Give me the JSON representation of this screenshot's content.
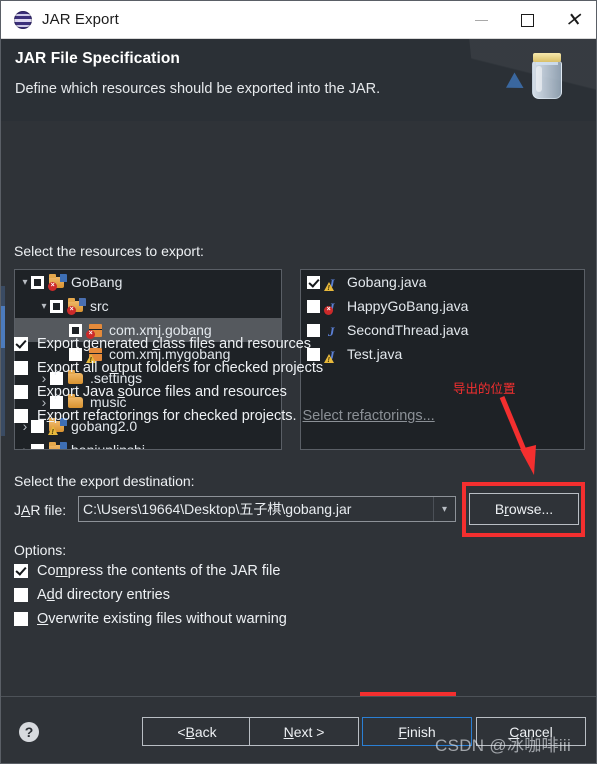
{
  "window": {
    "title": "JAR Export",
    "app_icon": "eclipse-icon",
    "minimize_label": "–",
    "maximize_label": "□",
    "close_label": "✕"
  },
  "header": {
    "title": "JAR File Specification",
    "subtitle": "Define which resources should be exported into the JAR.",
    "art_icon": "jar-export-banner-icon"
  },
  "resources": {
    "label": "Select the resources to export:",
    "tree": [
      {
        "indent": 0,
        "twisty": "down",
        "check": "grey",
        "icon": "project-folder-icon",
        "badge": "error",
        "label": "GoBang"
      },
      {
        "indent": 1,
        "twisty": "down",
        "check": "grey",
        "icon": "source-folder-icon",
        "badge": "error",
        "label": "src"
      },
      {
        "indent": 2,
        "twisty": "none",
        "check": "grey",
        "icon": "package-icon",
        "badge": "error",
        "label": "com.xmj.gobang",
        "selected": true
      },
      {
        "indent": 2,
        "twisty": "none",
        "check": "unchecked",
        "icon": "package-icon",
        "badge": "warning",
        "label": "com.xmj.mygobang"
      },
      {
        "indent": 1,
        "twisty": "right",
        "check": "unchecked",
        "icon": "folder-icon",
        "badge": "none",
        "label": ".settings"
      },
      {
        "indent": 1,
        "twisty": "right",
        "check": "unchecked",
        "icon": "folder-icon",
        "badge": "none",
        "label": "music"
      },
      {
        "indent": 0,
        "twisty": "right",
        "check": "unchecked",
        "icon": "project-folder-icon",
        "badge": "warning",
        "label": "gobang2.0"
      },
      {
        "indent": 0,
        "twisty": "right",
        "check": "unchecked",
        "icon": "project-folder-icon",
        "badge": "error",
        "label": "banjunlinshi"
      }
    ],
    "files": [
      {
        "check": "checked",
        "icon": "java-file-icon",
        "badge": "warning",
        "label": "Gobang.java"
      },
      {
        "check": "unchecked",
        "icon": "java-file-icon",
        "badge": "error",
        "label": "HappyGoBang.java"
      },
      {
        "check": "unchecked",
        "icon": "java-file-icon",
        "badge": "none",
        "label": "SecondThread.java"
      },
      {
        "check": "unchecked",
        "icon": "java-file-icon",
        "badge": "warning",
        "label": "Test.java"
      }
    ]
  },
  "export_options": [
    {
      "checked": true,
      "pre": "Export generated ",
      "mnemonic": "c",
      "post": "lass files and resources"
    },
    {
      "checked": false,
      "pre": "Export all o",
      "mnemonic": "u",
      "post": "tput folders for checked projects"
    },
    {
      "checked": false,
      "pre": "Export Java ",
      "mnemonic": "s",
      "post": "ource files and resources"
    },
    {
      "checked": false,
      "pre": "E",
      "mnemonic": "x",
      "post": "port refactorings for checked projects.",
      "link": "Select refactorings..."
    }
  ],
  "destination": {
    "label": "Select the export destination:",
    "field_label_pre": "J",
    "field_label_mnemonic": "A",
    "field_label_post": "R file:",
    "jar_file_value": "C:\\Users\\19664\\Desktop\\五子棋\\gobang.jar",
    "jar_file_placeholder": "",
    "combo_arrow": "chevron-down-icon",
    "browse_pre": "B",
    "browse_mnemonic": "r",
    "browse_post": "owse..."
  },
  "options": {
    "label": "Options:",
    "items": [
      {
        "checked": true,
        "pre": "Co",
        "mnemonic": "m",
        "post": "press the contents of the JAR file"
      },
      {
        "checked": false,
        "pre": "A",
        "mnemonic": "d",
        "post": "d directory entries"
      },
      {
        "checked": false,
        "pre": "",
        "mnemonic": "O",
        "post": "verwrite existing files without warning"
      }
    ]
  },
  "annotation": {
    "text": "导出的位置",
    "color": "#f42f2f"
  },
  "footer": {
    "help_icon": "help-question-icon",
    "buttons": [
      {
        "name": "back",
        "pre": "< ",
        "mnemonic": "B",
        "post": "ack"
      },
      {
        "name": "next",
        "pre": "",
        "mnemonic": "N",
        "post": "ext >"
      },
      {
        "name": "finish",
        "pre": "",
        "mnemonic": "F",
        "post": "inish"
      },
      {
        "name": "cancel",
        "pre": "",
        "mnemonic": "C",
        "post": "ancel"
      }
    ],
    "watermark": "CSDN @冰咖啡iii"
  },
  "colors": {
    "dialog_bg": "#2f3338",
    "header_bg": "#2b3036",
    "pane_bg": "#1e2226",
    "text": "#eef1f4",
    "accent_red": "#f42f2f",
    "focus_blue": "#2a7fd4"
  }
}
